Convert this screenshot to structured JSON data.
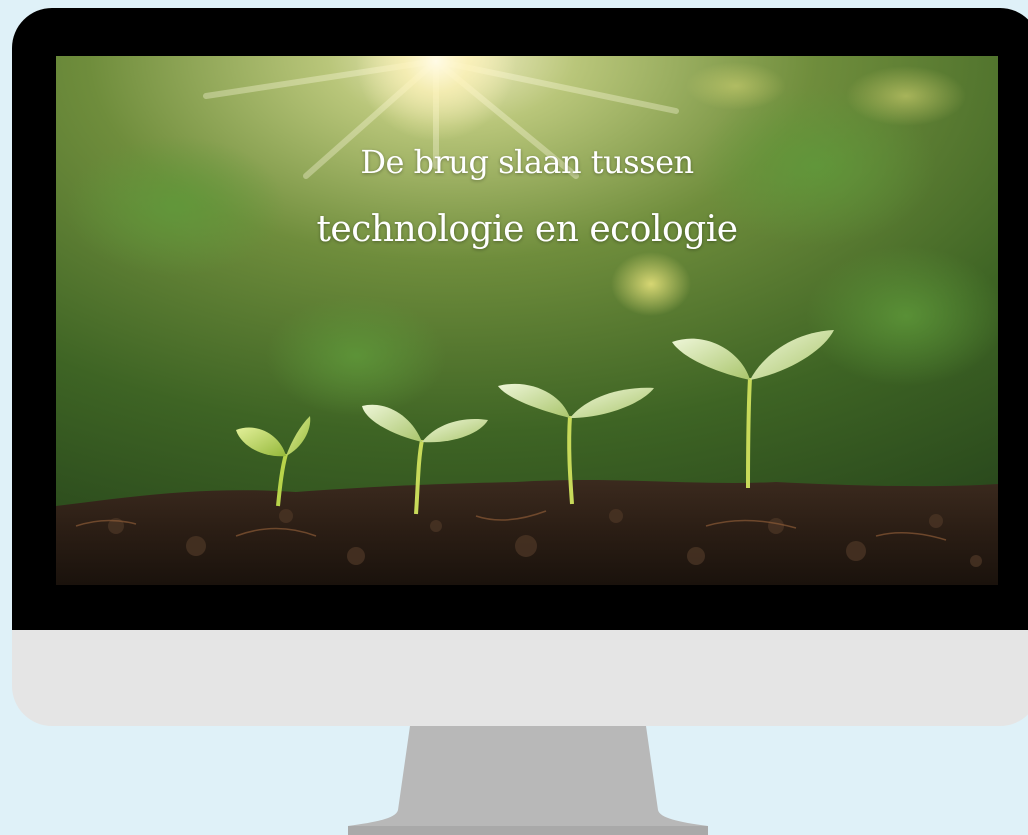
{
  "screen": {
    "headline_line1": "De brug slaan tussen",
    "headline_line2": "technologie en ecologie"
  },
  "colors": {
    "background": "#dff1f8",
    "bezel": "#000000",
    "chin": "#e5e5e5",
    "stand": "#b8b8b8"
  },
  "image": {
    "description_icons": [
      "seedling-icon",
      "soil",
      "sunlight"
    ]
  }
}
